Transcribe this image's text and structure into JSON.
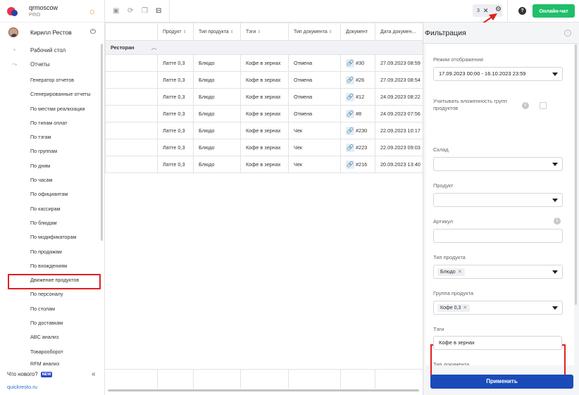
{
  "brand": {
    "name": "qrmoscow",
    "plan": "PRO"
  },
  "user": {
    "name": "Кирилл Рестов"
  },
  "nav": {
    "desktop": "Рабочий стол",
    "reports": "Отчеты",
    "reports_items": [
      "Генератор отчетов",
      "Сгенерированные отчеты",
      "По местам реализации",
      "По типам оплат",
      "По тэгам",
      "По группам",
      "По дням",
      "По часам",
      "По официантам",
      "По кассирам",
      "По блюдам",
      "По модификаторам",
      "По продажам",
      "По вхождениям",
      "Движение продуктов",
      "По персоналу",
      "По столам",
      "По доставкам",
      "ABC анализ",
      "Товарооборот",
      "RFM анализ"
    ],
    "active_index": 14,
    "whats_new": "Что нового?",
    "new_badge": "NEW",
    "footer_link": "quickresto.ru"
  },
  "toolbar": {
    "filter_count": "3",
    "chat_label": "Онлайн-чат",
    "help_label": "?"
  },
  "table": {
    "columns": [
      "",
      "Продукт",
      "Тип продукта",
      "Тэги",
      "Тип документа",
      "Документ",
      "Дата докумен..."
    ],
    "group": "Ресторан",
    "rows": [
      [
        "",
        "Латте 0,3",
        "Блюдо",
        "Кофе в зернах",
        "Отмена",
        "#30",
        "27.09.2023 08:59"
      ],
      [
        "",
        "Латте 0,3",
        "Блюдо",
        "Кофе в зернах",
        "Отмена",
        "#26",
        "27.09.2023 08:54"
      ],
      [
        "",
        "Латте 0,3",
        "Блюдо",
        "Кофе в зернах",
        "Отмена",
        "#12",
        "24.09.2023 08:22"
      ],
      [
        "",
        "Латте 0,3",
        "Блюдо",
        "Кофе в зернах",
        "Отмена",
        "#8",
        "24.09.2023 07:56"
      ],
      [
        "",
        "Латте 0,3",
        "Блюдо",
        "Кофе в зернах",
        "Чек",
        "#230",
        "22.09.2023 10:17"
      ],
      [
        "",
        "Латте 0,3",
        "Блюдо",
        "Кофе в зернах",
        "Чек",
        "#223",
        "22.09.2023 09:03"
      ],
      [
        "",
        "Латте 0,3",
        "Блюдо",
        "Кофе в зернах",
        "Чек",
        "#216",
        "20.09.2023 13:40"
      ]
    ]
  },
  "filter": {
    "title": "Фильтрация",
    "display_mode_label": "Режим отображения",
    "display_mode_value": "17.09.2023 00:00 - 16.10.2023 23:59",
    "nested_label": "Учитывать вложенность групп продуктов",
    "warehouse_label": "Склад",
    "product_label": "Продукт",
    "article_label": "Артикул",
    "product_type_label": "Тип продукта",
    "product_type_tag": "Блюдо",
    "product_group_label": "Группа продукта",
    "product_group_tag": "Кофе 0,3",
    "tags_label": "Тэги",
    "tags_value": "Кофе в зернах",
    "doc_type_label": "Тип документа",
    "apply_label": "Применить"
  },
  "colors": {
    "accent_blue": "#1a4bb8",
    "chat_green": "#1fbf6a",
    "highlight_red": "#e02020"
  }
}
